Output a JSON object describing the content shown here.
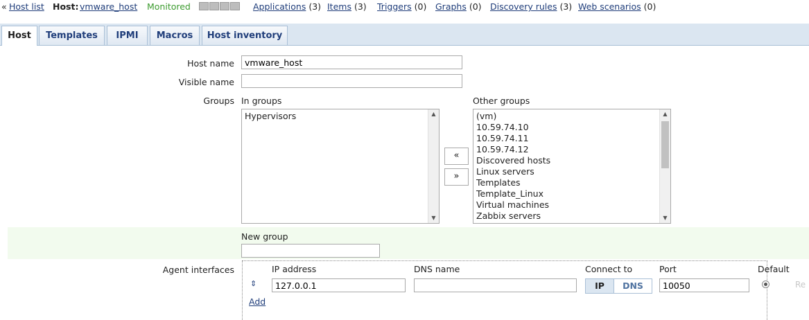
{
  "topbar": {
    "back_arrow": "«",
    "host_list": "Host list",
    "host_prefix": "Host:",
    "host_name": "vmware_host",
    "status": "Monitored",
    "availability_icons": [
      "zabbix-availability-icon",
      "snmp-availability-icon",
      "jmx-availability-icon",
      "ipmi-availability-icon"
    ],
    "links": [
      {
        "label": "Applications",
        "count": "(3)"
      },
      {
        "label": "Items",
        "count": "(3)"
      },
      {
        "label": "Triggers",
        "count": "(0)"
      },
      {
        "label": "Graphs",
        "count": "(0)"
      },
      {
        "label": "Discovery rules",
        "count": "(3)"
      },
      {
        "label": "Web scenarios",
        "count": "(0)"
      }
    ]
  },
  "tabs": [
    {
      "label": "Host",
      "active": true
    },
    {
      "label": "Templates",
      "active": false
    },
    {
      "label": "IPMI",
      "active": false
    },
    {
      "label": "Macros",
      "active": false
    },
    {
      "label": "Host inventory",
      "active": false
    }
  ],
  "form": {
    "host_name_label": "Host name",
    "host_name_value": "vmware_host",
    "visible_name_label": "Visible name",
    "visible_name_value": "",
    "groups_label": "Groups",
    "in_groups_label": "In groups",
    "in_groups": [
      "Hypervisors"
    ],
    "other_groups_label": "Other groups",
    "other_groups": [
      "(vm)",
      "10.59.74.10",
      "10.59.74.11",
      "10.59.74.12",
      "Discovered hosts",
      "Linux servers",
      "Templates",
      "Template_Linux",
      "Virtual machines",
      "Zabbix servers"
    ],
    "move_left": "«",
    "move_right": "»",
    "new_group_label": "New group",
    "new_group_value": "",
    "agent_interfaces_label": "Agent interfaces",
    "iface_headers": {
      "ip": "IP address",
      "dns": "DNS name",
      "connect": "Connect to",
      "port": "Port",
      "default": "Default"
    },
    "iface": {
      "ip": "127.0.0.1",
      "dns": "",
      "connect_ip": "IP",
      "connect_dns": "DNS",
      "port": "10050",
      "remove": "Re"
    },
    "add_label": "Add"
  },
  "colors": {
    "tab_bg": "#dbe6f1",
    "link": "#1f3d7a",
    "monitored": "#3c9b2e",
    "new_group_bg": "#f2fbee"
  }
}
